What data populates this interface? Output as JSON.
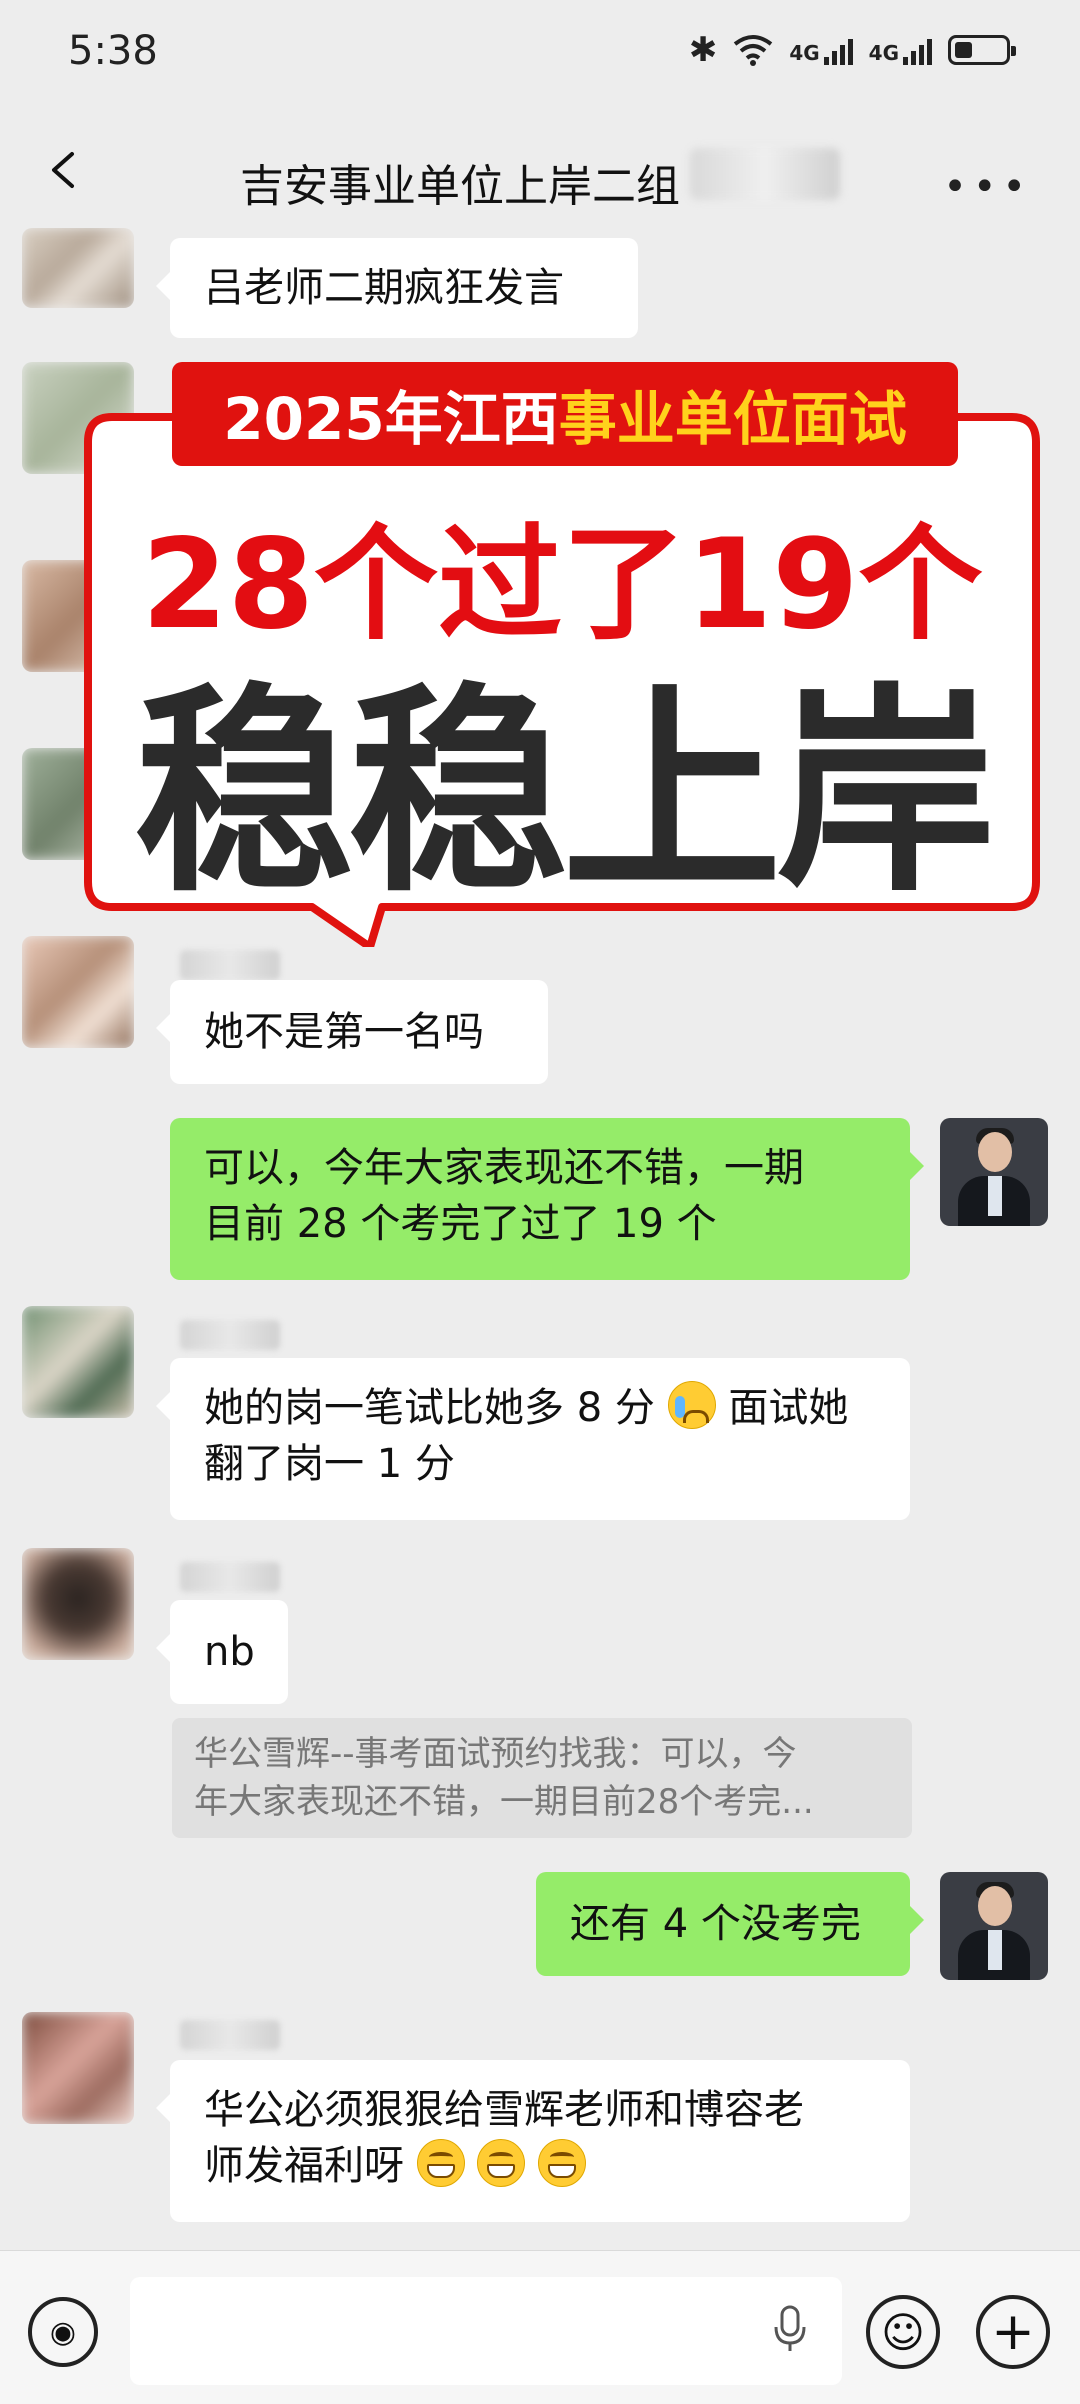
{
  "status_bar": {
    "time": "5:38",
    "signal_1_label": "4G",
    "signal_2_label": "4G",
    "battery_fraction": 0.35,
    "icons": [
      "bluetooth-icon",
      "wifi-icon",
      "signal-icon",
      "battery-icon"
    ]
  },
  "nav": {
    "title": "吉安事业单位上岸二组",
    "back_icon": "chevron-left-icon",
    "more_icon": "more-dots-icon"
  },
  "overlay": {
    "banner_prefix": "2025年江西",
    "banner_highlight": "事业单位面试",
    "headline": "28个过了19个",
    "slogan": "稳稳上岸",
    "colors": {
      "red": "#e0120f",
      "yellow": "#ffd21c",
      "black": "#2b2b2b"
    }
  },
  "messages": [
    {
      "side": "left",
      "text": "吕老师二期疯狂发言"
    },
    {
      "side": "left",
      "text": "她不是第一名吗"
    },
    {
      "side": "right",
      "line1": "可以，今年大家表现还不错，一期",
      "line2": "目前 28 个考完了过了 19 个"
    },
    {
      "side": "left",
      "line1_a": "她的岗一笔试比她多 8 分",
      "line1_b": " 面试她",
      "line2": "翻了岗一 1 分",
      "emoji": "crying-face-icon"
    },
    {
      "side": "left",
      "text": "nb"
    },
    {
      "side": "right",
      "text": "还有 4 个没考完"
    },
    {
      "side": "left",
      "line1": "华公必须狠狠给雪辉老师和博容老",
      "line2": "师发福利呀",
      "emoji": "grinning-face-icon"
    }
  ],
  "quote": {
    "line1": "华公雪辉--事考面试预约找我：可以，今",
    "line2": "年大家表现还不错，一期目前28个考完..."
  },
  "input_bar": {
    "voice_icon": "voice-icon",
    "mic_icon": "microphone-icon",
    "emoji_icon": "smiley-icon",
    "plus_icon": "plus-icon"
  },
  "colors": {
    "chat_bg": "#ededed",
    "sent_bubble": "#95ec69",
    "received_bubble": "#ffffff"
  }
}
